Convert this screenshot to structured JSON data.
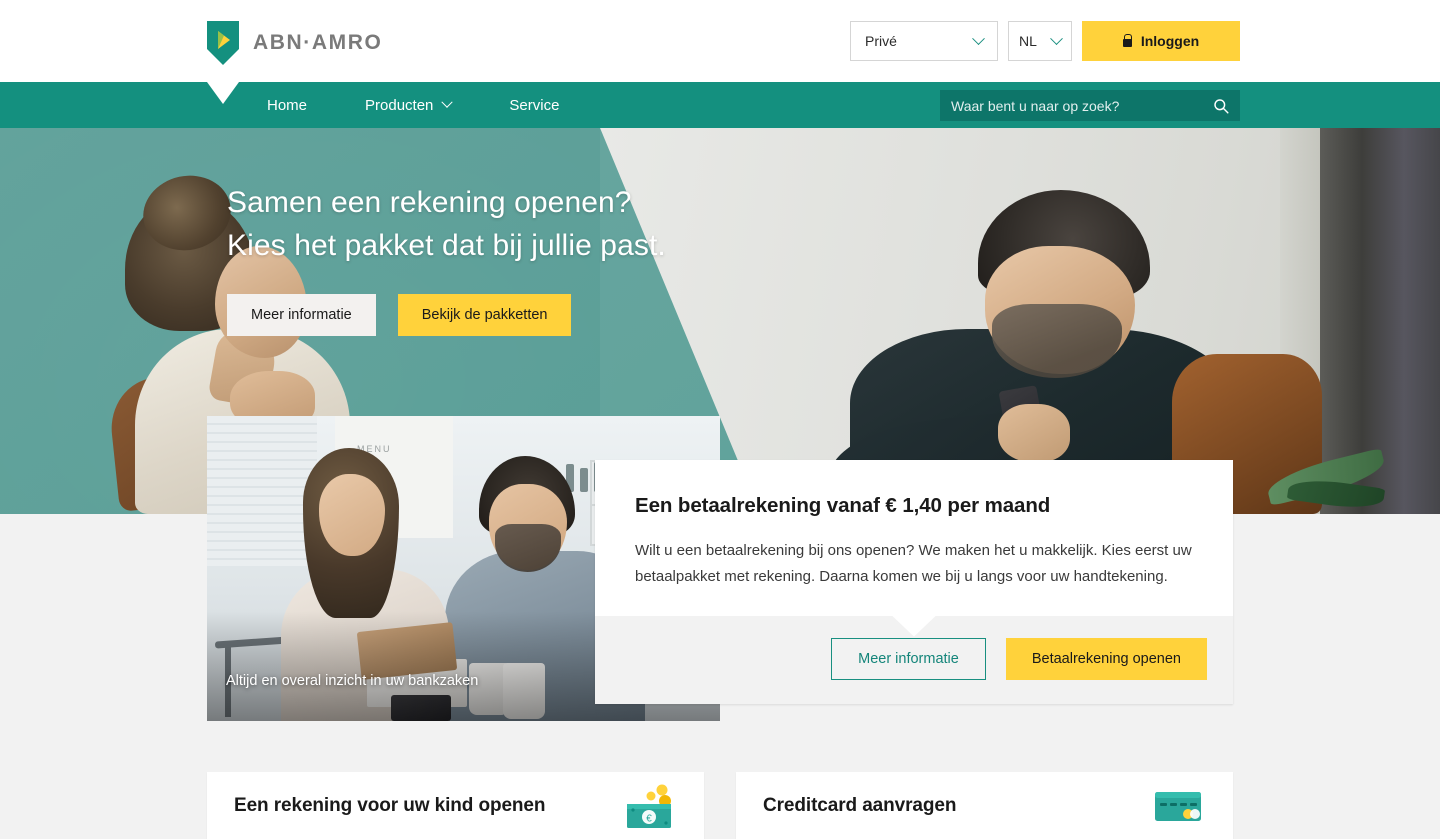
{
  "brand": {
    "name": "ABN·AMRO",
    "logo_icon": "abn-amro-shield-logo",
    "teal": "#14907f",
    "teal_dark": "#0d7569",
    "yellow": "#ffd23b",
    "page_bg": "#f2f2f2"
  },
  "header": {
    "segment_select": {
      "value": "Privé",
      "icon": "chevron-down-icon"
    },
    "language_select": {
      "value": "NL",
      "icon": "chevron-down-icon"
    },
    "login_button": {
      "label": "Inloggen",
      "icon": "lock-icon"
    }
  },
  "nav": {
    "items": [
      {
        "label": "Home",
        "has_chevron": false
      },
      {
        "label": "Producten",
        "has_chevron": true,
        "icon": "chevron-down-icon"
      },
      {
        "label": "Service",
        "has_chevron": false
      }
    ],
    "search": {
      "placeholder": "Waar bent u naar op zoek?",
      "value": "",
      "icon": "search-icon"
    }
  },
  "hero": {
    "title_line1": "Samen een rekening openen?",
    "title_line2": "Kies het pakket dat bij jullie past.",
    "buttons": [
      {
        "label": "Meer informatie",
        "style": "light"
      },
      {
        "label": "Bekijk de pakketten",
        "style": "yellow"
      }
    ]
  },
  "photo_card": {
    "caption": "Altijd en overal inzicht in uw bankzaken",
    "poster_text": "MENU"
  },
  "offer_card": {
    "title": "Een betaalrekening vanaf € 1,40 per maand",
    "body": "Wilt u een betaalrekening bij ons openen? We maken het u makkelijk. Kies eerst uw betaalpakket met rekening. Daarna komen we bij u langs voor uw handtekening.",
    "buttons": [
      {
        "label": "Meer informatie",
        "style": "outline"
      },
      {
        "label": "Betaalrekening openen",
        "style": "yellow"
      }
    ]
  },
  "tiles": [
    {
      "title": "Een rekening voor uw kind openen",
      "icon": "money-coins-icon"
    },
    {
      "title": "Creditcard aanvragen",
      "icon": "credit-card-icon"
    }
  ]
}
